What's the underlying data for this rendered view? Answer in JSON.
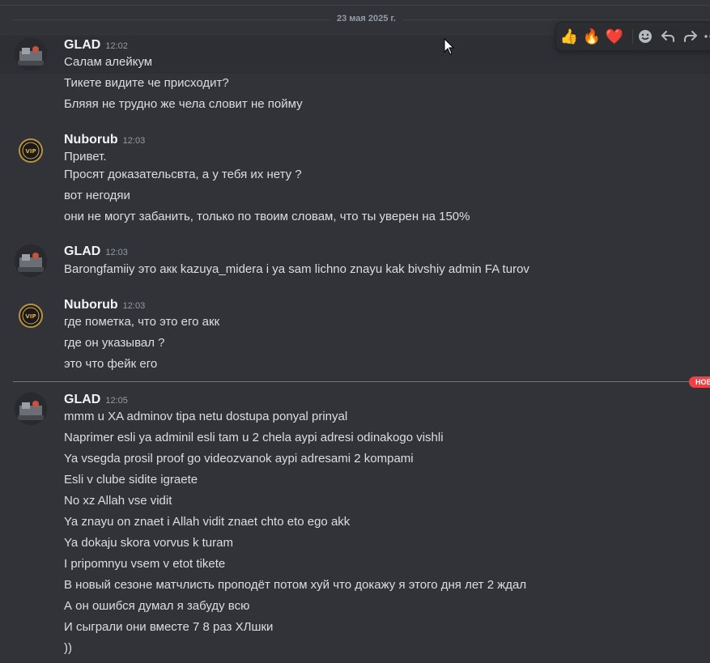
{
  "date_divider": "23 мая 2025 г.",
  "new_badge": "НОВ",
  "toolbar": {
    "reactions": [
      "👍",
      "🔥",
      "❤️"
    ],
    "icons": [
      "add-reaction-icon",
      "reply-icon",
      "forward-icon",
      "more-icon"
    ]
  },
  "groups": [
    {
      "username": "GLAD",
      "timestamp": "12:02",
      "lines": [
        "Салам алейкум",
        "Тикете видите че присходит?",
        "Бляяя не трудно же чела словит не пойму"
      ]
    },
    {
      "username": "Nuborub",
      "timestamp": "12:03",
      "lines": [
        "Привет.",
        "Просят доказательсвта, а у тебя их нету ?",
        "вот негодяи",
        "они не могут забанить, только по твоим словам, что ты уверен на 150%"
      ]
    },
    {
      "username": "GLAD",
      "timestamp": "12:03",
      "lines": [
        "Barongfamiiy это акк kazuya_midera i ya sam lichno znayu kak bivshiy admin FA turov"
      ]
    },
    {
      "username": "Nuborub",
      "timestamp": "12:03",
      "lines": [
        "где пометка, что это его акк",
        "где он указывал ?",
        "это что фейк его"
      ]
    },
    {
      "username": "GLAD",
      "timestamp": "12:05",
      "lines": [
        "mmm u XA adminov tipa netu dostupa ponyal prinyal",
        "Naprimer esli ya adminil esli tam u 2 chela aypi adresi odinakogo vishli",
        "Ya vsegda prosil proof go videozvanok aypi adresami 2 kompami",
        "Esli v clube sidite igraete",
        "No xz Allah vse vidit",
        "Ya znayu on znaet i Allah vidit znaet chto eto ego akk",
        "Ya dokaju skora vorvus k turam",
        "I pripomnyu vsem v etot tikete",
        "В новый сезоне матчлисть проподёт потом хуй что докажу я этого дня лет 2 ждал",
        "А он ошибся думал я забуду всю",
        "И сыграли они вместе 7 8 раз ХЛшки",
        "))"
      ]
    }
  ]
}
